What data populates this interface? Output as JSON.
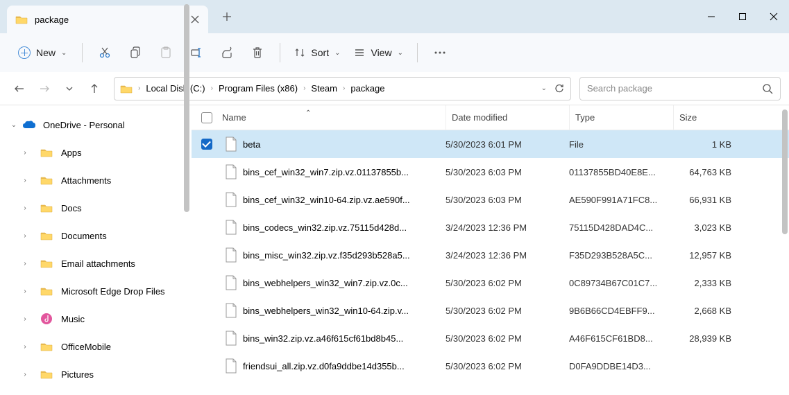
{
  "tab": {
    "title": "package"
  },
  "toolbar": {
    "new": "New",
    "sort": "Sort",
    "view": "View"
  },
  "breadcrumb": [
    "Local Disk (C:)",
    "Program Files (x86)",
    "Steam",
    "package"
  ],
  "search": {
    "placeholder": "Search package"
  },
  "sidebar": {
    "root": "OneDrive - Personal",
    "items": [
      "Apps",
      "Attachments",
      "Docs",
      "Documents",
      "Email attachments",
      "Microsoft Edge Drop Files",
      "Music",
      "OfficeMobile",
      "Pictures"
    ]
  },
  "columns": {
    "name": "Name",
    "date": "Date modified",
    "type": "Type",
    "size": "Size"
  },
  "files": [
    {
      "name": "beta",
      "date": "5/30/2023 6:01 PM",
      "type": "File",
      "size": "1 KB",
      "selected": true
    },
    {
      "name": "bins_cef_win32_win7.zip.vz.01137855b...",
      "date": "5/30/2023 6:03 PM",
      "type": "01137855BD40E8E...",
      "size": "64,763 KB"
    },
    {
      "name": "bins_cef_win32_win10-64.zip.vz.ae590f...",
      "date": "5/30/2023 6:03 PM",
      "type": "AE590F991A71FC8...",
      "size": "66,931 KB"
    },
    {
      "name": "bins_codecs_win32.zip.vz.75115d428d...",
      "date": "3/24/2023 12:36 PM",
      "type": "75115D428DAD4C...",
      "size": "3,023 KB"
    },
    {
      "name": "bins_misc_win32.zip.vz.f35d293b528a5...",
      "date": "3/24/2023 12:36 PM",
      "type": "F35D293B528A5C...",
      "size": "12,957 KB"
    },
    {
      "name": "bins_webhelpers_win32_win7.zip.vz.0c...",
      "date": "5/30/2023 6:02 PM",
      "type": "0C89734B67C01C7...",
      "size": "2,333 KB"
    },
    {
      "name": "bins_webhelpers_win32_win10-64.zip.v...",
      "date": "5/30/2023 6:02 PM",
      "type": "9B6B66CD4EBFF9...",
      "size": "2,668 KB"
    },
    {
      "name": "bins_win32.zip.vz.a46f615cf61bd8b45...",
      "date": "5/30/2023 6:02 PM",
      "type": "A46F615CF61BD8...",
      "size": "28,939 KB"
    },
    {
      "name": "friendsui_all.zip.vz.d0fa9ddbe14d355b...",
      "date": "5/30/2023 6:02 PM",
      "type": "D0FA9DDBE14D3...",
      "size": ""
    }
  ]
}
